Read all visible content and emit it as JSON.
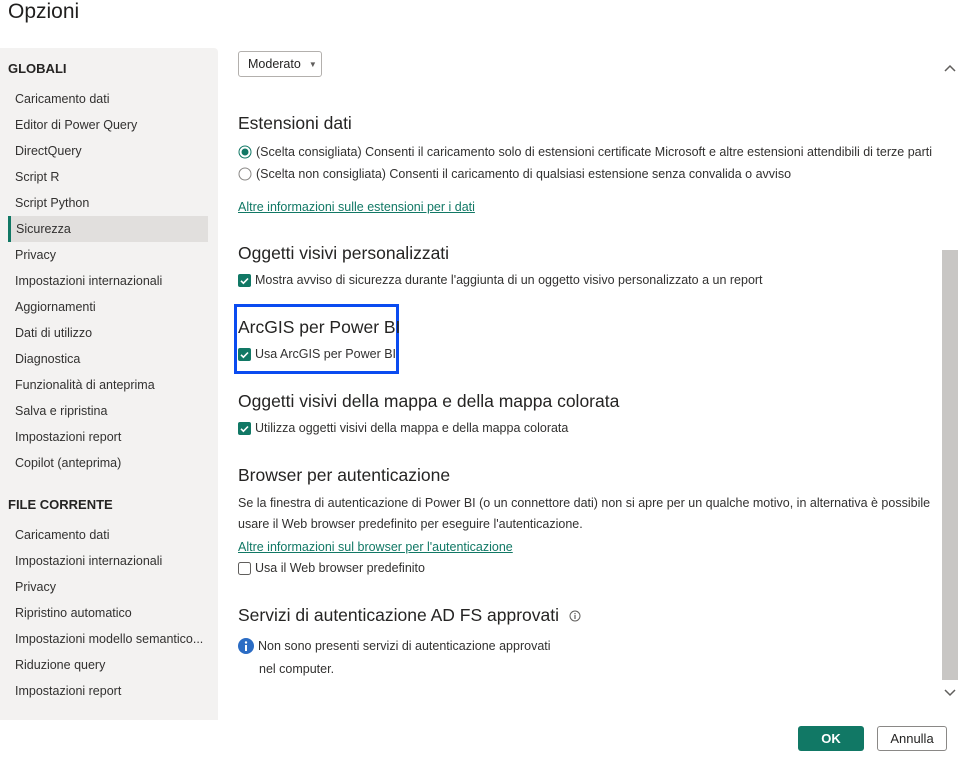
{
  "window": {
    "title": "Opzioni"
  },
  "sidebar": {
    "global_header": "GLOBALI",
    "global_items": [
      "Caricamento dati",
      "Editor di Power Query",
      "DirectQuery",
      "Script R",
      "Script Python",
      "Sicurezza",
      "Privacy",
      "Impostazioni internazionali",
      "Aggiornamenti",
      "Dati di utilizzo",
      "Diagnostica",
      "Funzionalità di anteprima",
      "Salva e ripristina",
      "Impostazioni report",
      "Copilot (anteprima)"
    ],
    "selected": "Sicurezza",
    "file_header": "FILE CORRENTE",
    "file_items": [
      "Caricamento dati",
      "Impostazioni internazionali",
      "Privacy",
      "Ripristino automatico",
      "Impostazioni modello semantico...",
      "Riduzione query",
      "Impostazioni report"
    ]
  },
  "main": {
    "dropdown_value": "Moderato",
    "ext": {
      "heading": "Estensioni dati",
      "opt1": "(Scelta consigliata) Consenti il caricamento solo di estensioni certificate Microsoft e altre estensioni attendibili di terze parti",
      "opt2": "(Scelta non consigliata) Consenti il caricamento di qualsiasi estensione senza convalida o avviso",
      "selected": "opt1",
      "link": "Altre informazioni sulle estensioni per i dati"
    },
    "visuals": {
      "heading": "Oggetti visivi personalizzati",
      "check": "Mostra avviso di sicurezza durante l'aggiunta di un oggetto visivo personalizzato a un report",
      "checked": true
    },
    "arcgis": {
      "heading": "ArcGIS per Power BI",
      "check": "Usa ArcGIS per Power BI",
      "checked": true
    },
    "maps": {
      "heading": "Oggetti visivi della mappa e della mappa colorata",
      "check": "Utilizza oggetti visivi della mappa e della mappa colorata",
      "checked": true
    },
    "browser": {
      "heading": "Browser per autenticazione",
      "desc1": "Se la finestra di autenticazione di Power BI (o un connettore dati) non si apre per un qualche motivo, in alternativa è possibile",
      "desc2": "usare il Web browser predefinito per eseguire l'autenticazione.",
      "link": "Altre informazioni sul browser per l'autenticazione",
      "check": "Usa il Web browser predefinito",
      "checked": false
    },
    "adfs": {
      "heading": "Servizi di autenticazione AD FS approvati",
      "info1": "Non sono presenti servizi di autenticazione approvati",
      "info2": "nel computer."
    }
  },
  "footer": {
    "ok": "OK",
    "cancel": "Annulla"
  },
  "colors": {
    "accent": "#117865",
    "highlight": "#0a4bf0",
    "sidebar_bg": "#f3f2f1"
  }
}
